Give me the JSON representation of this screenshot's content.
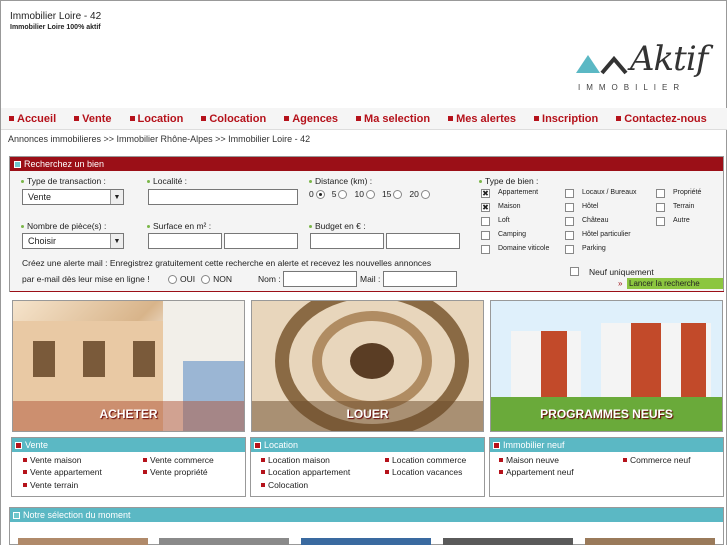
{
  "header": {
    "site_title": "Immobilier Loire - 42",
    "tagline": "Immobilier Loire 100% aktif",
    "logo_word": "Aktif",
    "logo_sub": "IMMOBILIER"
  },
  "nav": [
    "Accueil",
    "Vente",
    "Location",
    "Colocation",
    "Agences",
    "Ma selection",
    "Mes alertes",
    "Inscription",
    "Contactez-nous"
  ],
  "breadcrumb": "Annonces immobilieres >> Immobilier Rhône-Alpes >> Immobilier Loire - 42",
  "search": {
    "title": "Recherchez un bien",
    "transaction_label": "Type de transaction :",
    "transaction_value": "Vente",
    "locality_label": "Localité :",
    "distance_label": "Distance (km) :",
    "distance_options": [
      "0",
      "5",
      "10",
      "15",
      "20"
    ],
    "type_label": "Type de bien :",
    "types": [
      {
        "label": "Appartement",
        "checked": true
      },
      {
        "label": "Locaux / Bureaux",
        "checked": false
      },
      {
        "label": "Propriété",
        "checked": false
      },
      {
        "label": "Maison",
        "checked": true
      },
      {
        "label": "Hôtel",
        "checked": false
      },
      {
        "label": "Terrain",
        "checked": false
      },
      {
        "label": "Loft",
        "checked": false
      },
      {
        "label": "Château",
        "checked": false
      },
      {
        "label": "Autre",
        "checked": false
      },
      {
        "label": "Camping",
        "checked": false
      },
      {
        "label": "Hôtel particulier",
        "checked": false
      },
      {
        "label": "Domaine viticole",
        "checked": false
      },
      {
        "label": "Parking",
        "checked": false
      }
    ],
    "rooms_label": "Nombre de pièce(s) :",
    "rooms_value": "Choisir",
    "surface_label": "Surface en m² :",
    "budget_label": "Budget en € :",
    "alert_line1": "Créez une alerte mail : Enregistrez gratuitement cette recherche en alerte et recevez les nouvelles annonces",
    "alert_line2": "par e-mail dès leur mise en ligne !",
    "oui": "OUI",
    "non": "NON",
    "nom_label": "Nom :",
    "mail_label": "Mail :",
    "new_only": "Neuf uniquement",
    "submit": "Lancer la recherche"
  },
  "banners": [
    "ACHETER",
    "LOUER",
    "PROGRAMMES NEUFS"
  ],
  "categories": [
    {
      "title": "Vente",
      "links": [
        "Vente maison",
        "Vente commerce",
        "Vente appartement",
        "Vente propriété",
        "Vente terrain"
      ]
    },
    {
      "title": "Location",
      "links": [
        "Location maison",
        "Location commerce",
        "Location appartement",
        "Location vacances",
        "Colocation"
      ]
    },
    {
      "title": "Immobilier neuf",
      "links": [
        "Maison neuve",
        "Commerce neuf",
        "Appartement neuf"
      ]
    }
  ],
  "selection_title": "Notre sélection du moment",
  "colors": {
    "brand_red": "#9b0f17",
    "teal": "#5bb8c4",
    "green": "#8cc640"
  }
}
